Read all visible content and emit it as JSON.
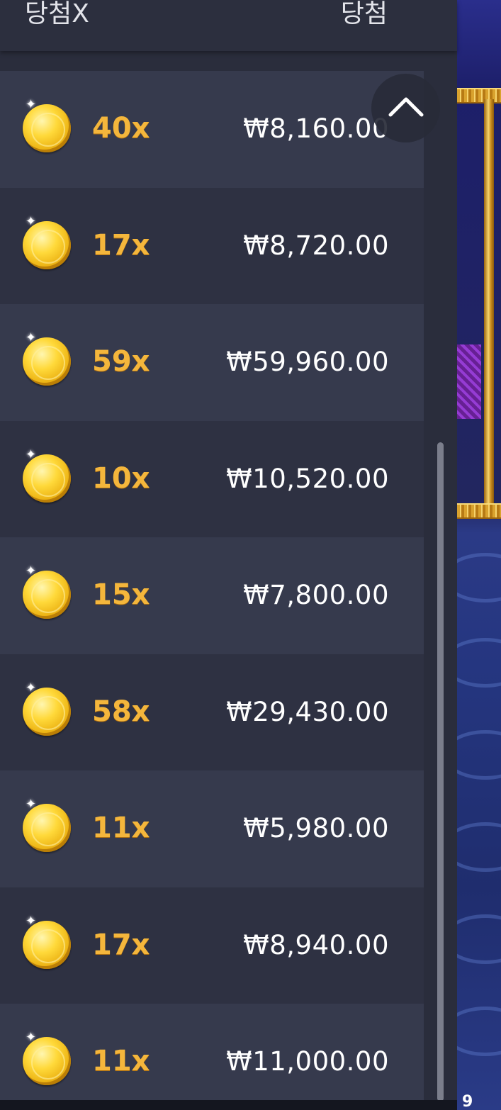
{
  "header": {
    "multiplier_label": "당첨X",
    "win_label": "당첨"
  },
  "currency_symbol": "₩",
  "rows": [
    {
      "multiplier": "40x",
      "amount": "₩8,160.00"
    },
    {
      "multiplier": "17x",
      "amount": "₩8,720.00"
    },
    {
      "multiplier": "59x",
      "amount": "₩59,960.00"
    },
    {
      "multiplier": "10x",
      "amount": "₩10,520.00"
    },
    {
      "multiplier": "15x",
      "amount": "₩7,800.00"
    },
    {
      "multiplier": "58x",
      "amount": "₩29,430.00"
    },
    {
      "multiplier": "11x",
      "amount": "₩5,980.00"
    },
    {
      "multiplier": "17x",
      "amount": "₩8,940.00"
    },
    {
      "multiplier": "11x",
      "amount": "₩11,000.00"
    }
  ],
  "icons": {
    "row_icon": "gold-coin-icon",
    "scroll_button_icon": "chevron-up-icon"
  },
  "colors": {
    "panel": "#2a2d3c",
    "row_light": "#363a4d",
    "row_dark": "#2e3142",
    "multiplier_gold": "#f4b63c",
    "amount_text": "#ffffff"
  },
  "footer": {
    "corner_number": "9"
  }
}
